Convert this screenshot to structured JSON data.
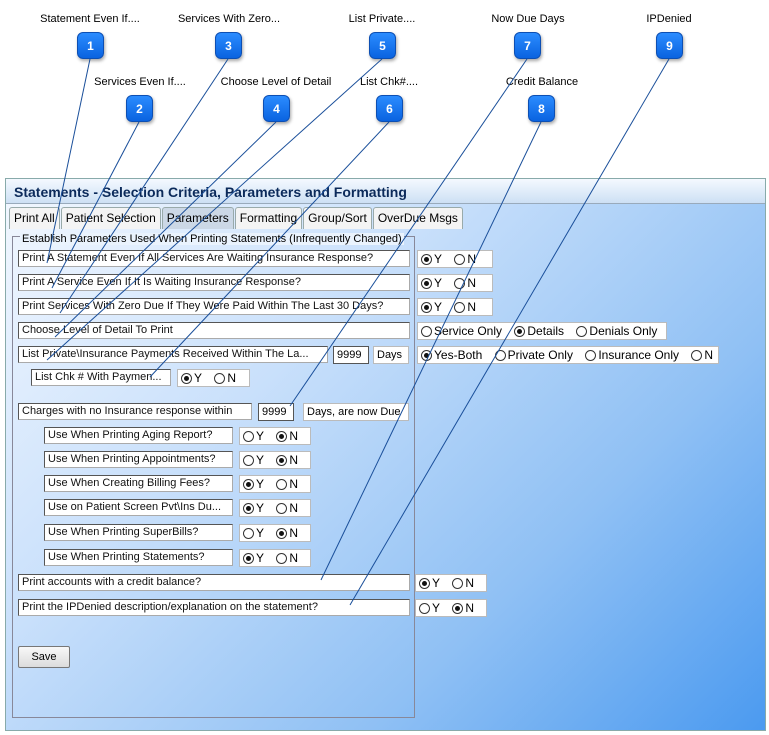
{
  "callouts": [
    {
      "num": "1",
      "label": "Statement Even If...."
    },
    {
      "num": "2",
      "label": "Services Even If...."
    },
    {
      "num": "3",
      "label": "Services With Zero..."
    },
    {
      "num": "4",
      "label": "Choose Level of Detail"
    },
    {
      "num": "5",
      "label": "List Private...."
    },
    {
      "num": "6",
      "label": "List Chk#...."
    },
    {
      "num": "7",
      "label": "Now Due Days"
    },
    {
      "num": "8",
      "label": "Credit Balance"
    },
    {
      "num": "9",
      "label": "IPDenied"
    }
  ],
  "window": {
    "title": "Statements - Selection Criteria, Parameters and Formatting"
  },
  "tabs": [
    "Print All",
    "Patient Selection",
    "Parameters",
    "Formatting",
    "Group/Sort",
    "OverDue Msgs"
  ],
  "active_tab": "Parameters",
  "group_title": "Establish Parameters Used When Printing Statements (Infrequently Changed)",
  "rows": {
    "r1": {
      "label": "Print A Statement Even If All Services Are Waiting Insurance Response?",
      "options": [
        "Y",
        "N"
      ],
      "selected": "Y"
    },
    "r2": {
      "label": "Print A Service Even If It Is Waiting Insurance Response?",
      "options": [
        "Y",
        "N"
      ],
      "selected": "Y"
    },
    "r3": {
      "label": "Print Services With Zero Due If They Were Paid Within The Last 30 Days?",
      "options": [
        "Y",
        "N"
      ],
      "selected": "Y"
    },
    "r4": {
      "label": "Choose Level of Detail To Print",
      "options": [
        "Service Only",
        "Details",
        "Denials Only"
      ],
      "selected": "Details"
    },
    "r5": {
      "label": "List Private\\Insurance Payments Received Within The La...",
      "days_value": "9999",
      "days_label": "Days",
      "options": [
        "Yes-Both",
        "Private Only",
        "Insurance Only",
        "N"
      ],
      "selected": "Yes-Both"
    },
    "r6": {
      "label": "List Chk # With Paymen...",
      "options": [
        "Y",
        "N"
      ],
      "selected": "Y"
    },
    "r7": {
      "label": "Charges with no Insurance response within",
      "days_value": "9999",
      "suffix": "Days, are now Due"
    },
    "sub": [
      {
        "label": "Use When Printing Aging Report?",
        "selected": "N"
      },
      {
        "label": "Use When Printing Appointments?",
        "selected": "N"
      },
      {
        "label": "Use When Creating Billing Fees?",
        "selected": "Y"
      },
      {
        "label": "Use on Patient Screen Pvt\\Ins Du...",
        "selected": "Y"
      },
      {
        "label": "Use When Printing SuperBills?",
        "selected": "N"
      },
      {
        "label": "Use When Printing Statements?",
        "selected": "Y"
      }
    ],
    "r8": {
      "label": "Print accounts with a credit balance?",
      "options": [
        "Y",
        "N"
      ],
      "selected": "Y"
    },
    "r9": {
      "label": "Print the IPDenied description/explanation on the statement?",
      "options": [
        "Y",
        "N"
      ],
      "selected": "N"
    }
  },
  "save_label": "Save"
}
